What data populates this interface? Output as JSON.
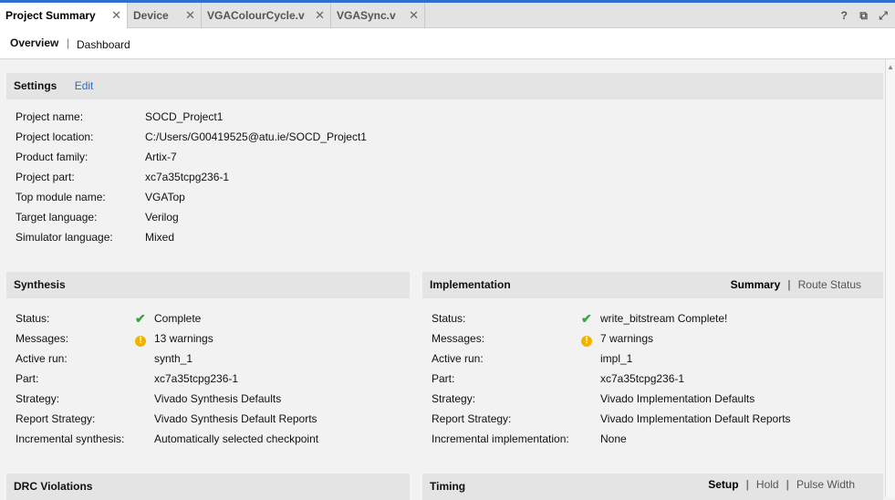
{
  "tabs": [
    {
      "label": "Project Summary",
      "active": true
    },
    {
      "label": "Device",
      "active": false
    },
    {
      "label": "VGAColourCycle.v",
      "active": false
    },
    {
      "label": "VGASync.v",
      "active": false
    }
  ],
  "window_icons": [
    "question-icon",
    "restore-icon",
    "maximize-icon"
  ],
  "subtabs": {
    "overview": "Overview",
    "dashboard": "Dashboard"
  },
  "settings": {
    "title": "Settings",
    "edit": "Edit",
    "rows": [
      {
        "key": "Project name:",
        "value": "SOCD_Project1",
        "link": false
      },
      {
        "key": "Project location:",
        "value": "C:/Users/G00419525@atu.ie/SOCD_Project1",
        "link": false
      },
      {
        "key": "Product family:",
        "value": "Artix-7",
        "link": false
      },
      {
        "key": "Project part:",
        "value": "xc7a35tcpg236-1",
        "link": true
      },
      {
        "key": "Top module name:",
        "value": "VGATop",
        "link": true
      },
      {
        "key": "Target language:",
        "value": "Verilog",
        "link": true
      },
      {
        "key": "Simulator language:",
        "value": "Mixed",
        "link": true
      }
    ]
  },
  "synthesis": {
    "title": "Synthesis",
    "rows": [
      {
        "key": "Status:",
        "value": "Complete",
        "icon": "check-icon",
        "link": false
      },
      {
        "key": "Messages:",
        "value": "13 warnings",
        "icon": "warning-icon",
        "link": true
      },
      {
        "key": "Active run:",
        "value": "synth_1",
        "link": true
      },
      {
        "key": "Part:",
        "value": "xc7a35tcpg236-1",
        "link": false
      },
      {
        "key": "Strategy:",
        "value": "Vivado Synthesis Defaults",
        "link": true
      },
      {
        "key": "Report Strategy:",
        "value": "Vivado Synthesis Default Reports",
        "link": true
      },
      {
        "key": "Incremental synthesis:",
        "value": "Automatically selected checkpoint",
        "link": true
      }
    ]
  },
  "implementation": {
    "title": "Implementation",
    "summary": "Summary",
    "route_status": "Route Status",
    "rows": [
      {
        "key": "Status:",
        "value": "write_bitstream Complete!",
        "icon": "check-icon",
        "link": false
      },
      {
        "key": "Messages:",
        "value": "7 warnings",
        "icon": "warning-icon",
        "link": true
      },
      {
        "key": "Active run:",
        "value": "impl_1",
        "link": true
      },
      {
        "key": "Part:",
        "value": "xc7a35tcpg236-1",
        "link": false
      },
      {
        "key": "Strategy:",
        "value": "Vivado Implementation Defaults",
        "link": true
      },
      {
        "key": "Report Strategy:",
        "value": "Vivado Implementation Default Reports",
        "link": true
      },
      {
        "key": "Incremental implementation:",
        "value": "None",
        "link": true
      }
    ]
  },
  "drc": {
    "title": "DRC Violations"
  },
  "timing": {
    "title": "Timing",
    "setup": "Setup",
    "hold": "Hold",
    "pulse_width": "Pulse Width"
  },
  "colors": {
    "link": "#2a6ac8",
    "accent": "#2f6fd0",
    "check": "#3aa53a",
    "warning": "#f0b400"
  }
}
